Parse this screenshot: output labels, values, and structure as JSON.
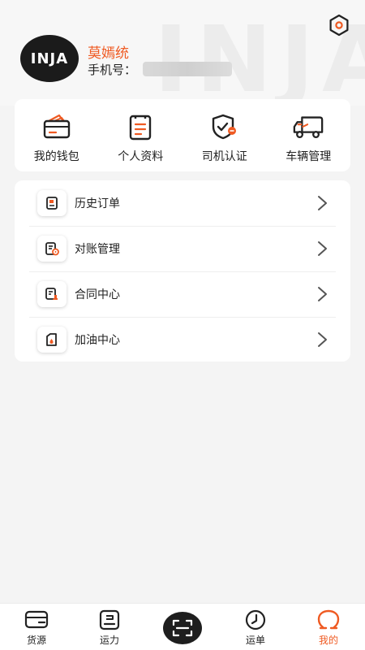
{
  "header": {
    "watermark": "INJA",
    "avatar_text": "INJA",
    "user_name": "莫嫣统",
    "phone_label": "手机号：",
    "phone_value": ""
  },
  "quick_actions": [
    {
      "label": "我的钱包",
      "icon": "wallet-icon"
    },
    {
      "label": "个人资料",
      "icon": "profile-document-icon"
    },
    {
      "label": "司机认证",
      "icon": "shield-check-icon"
    },
    {
      "label": "车辆管理",
      "icon": "truck-icon"
    }
  ],
  "menu": [
    {
      "label": "历史订单",
      "icon": "order-history-icon"
    },
    {
      "label": "对账管理",
      "icon": "reconciliation-icon"
    },
    {
      "label": "合同中心",
      "icon": "contract-icon"
    },
    {
      "label": "加油中心",
      "icon": "fuel-icon"
    }
  ],
  "tabbar": {
    "items": [
      {
        "label": "货源",
        "icon": "cargo-icon"
      },
      {
        "label": "运力",
        "icon": "capacity-icon"
      },
      {
        "label": "运单",
        "icon": "waybill-clock-icon"
      },
      {
        "label": "我的",
        "icon": "mine-icon",
        "active": true
      }
    ]
  },
  "colors": {
    "accent": "#ef5a22",
    "text": "#222222",
    "background": "#f4f4f4",
    "card": "#ffffff"
  }
}
